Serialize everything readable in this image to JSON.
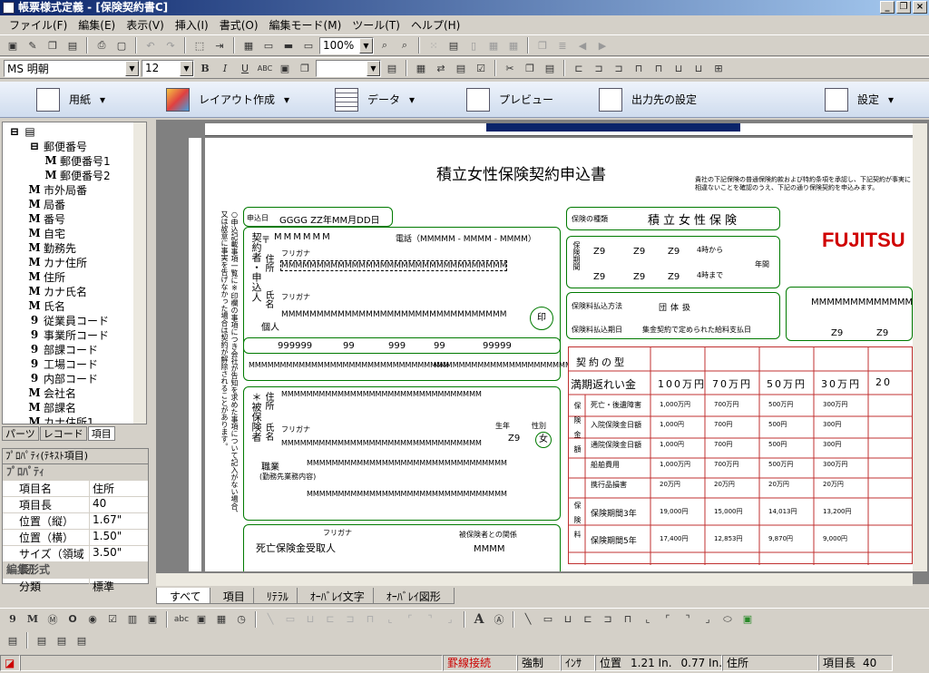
{
  "window": {
    "title": "帳票様式定義 - [保険契約書C]"
  },
  "menu": [
    "ファイル(F)",
    "編集(E)",
    "表示(V)",
    "挿入(I)",
    "書式(O)",
    "編集モード(M)",
    "ツール(T)",
    "ヘルプ(H)"
  ],
  "toolbar": {
    "zoom": "100%",
    "font": "MS 明朝",
    "size": "12",
    "bold": "B",
    "italic": "I",
    "underline": "U",
    "abc": "ABC"
  },
  "ribbon": [
    {
      "label": "用紙",
      "arrow": "▾"
    },
    {
      "label": "レイアウト作成",
      "arrow": "▾"
    },
    {
      "label": "データ",
      "arrow": "▾"
    },
    {
      "label": "プレビュー",
      "arrow": ""
    },
    {
      "label": "出力先の設定",
      "arrow": ""
    },
    {
      "label": "設定",
      "arrow": "▾"
    }
  ],
  "tree": {
    "items": [
      {
        "icon": "⊟",
        "label": "郵便番号",
        "indent": 1
      },
      {
        "icon": "M",
        "label": "郵便番号1",
        "indent": 2
      },
      {
        "icon": "M",
        "label": "郵便番号2",
        "indent": 2
      },
      {
        "icon": "M",
        "label": "市外局番",
        "indent": 1
      },
      {
        "icon": "M",
        "label": "局番",
        "indent": 1
      },
      {
        "icon": "M",
        "label": "番号",
        "indent": 1
      },
      {
        "icon": "M",
        "label": "自宅",
        "indent": 1
      },
      {
        "icon": "M",
        "label": "勤務先",
        "indent": 1
      },
      {
        "icon": "M",
        "label": "カナ住所",
        "indent": 1
      },
      {
        "icon": "M",
        "label": "住所",
        "indent": 1
      },
      {
        "icon": "M",
        "label": "カナ氏名",
        "indent": 1
      },
      {
        "icon": "M",
        "label": "氏名",
        "indent": 1
      },
      {
        "icon": "9",
        "label": "従業員コード",
        "indent": 1
      },
      {
        "icon": "9",
        "label": "事業所コード",
        "indent": 1
      },
      {
        "icon": "9",
        "label": "部課コード",
        "indent": 1
      },
      {
        "icon": "9",
        "label": "工場コード",
        "indent": 1
      },
      {
        "icon": "9",
        "label": "内部コード",
        "indent": 1
      },
      {
        "icon": "M",
        "label": "会社名",
        "indent": 1
      },
      {
        "icon": "M",
        "label": "部課名",
        "indent": 1
      },
      {
        "icon": "M",
        "label": "カナ住所1",
        "indent": 1
      }
    ],
    "tabs": [
      "パーツ",
      "レコード",
      "項目"
    ]
  },
  "props": {
    "header": "ﾌﾟﾛﾊﾟﾃｨ(ﾃｷｽﾄ項目)",
    "section1": "ﾌﾟﾛﾊﾟﾃｨ",
    "rows": [
      {
        "k": "項目名",
        "v": "住所"
      },
      {
        "k": "項目長",
        "v": "40"
      },
      {
        "k": "位置（縦）",
        "v": "1.67\""
      },
      {
        "k": "位置（横）",
        "v": "1.50\""
      },
      {
        "k": "サイズ（領域長）",
        "v": "3.50\""
      }
    ],
    "section2": "編集形式",
    "rows2": [
      {
        "k": "分類",
        "v": "標準"
      }
    ]
  },
  "form": {
    "title": "積立女性保険契約申込書",
    "brand": "FUJITSU",
    "notice": "貴社の下記保険の普通保険約款および特約条項を承認し、下記契約が事実に相違ないことを確認のうえ、下記の通り保険契約を申込みます。",
    "left_notice": "○申込記載事項一覧に※印欄の事項につき会社が告知を求めた事項について記入がない場合、又は故意に事実を告げなかった場合は契約が解除されることがあります。",
    "date_label": "申込日",
    "date_val": "GGGG ZZ年MM月DD日",
    "zip_label": "〒",
    "zip_val": "MMMMMM",
    "tel_label": "電話（MMMMM - MMMM - MMMM）",
    "keiyakusha": "契約者・申込人",
    "furigana": "フリガナ",
    "addr_label": "住所",
    "name_label": "氏名",
    "kojin": "個人",
    "stamp": "印",
    "codes": [
      "999999",
      "99",
      "999",
      "99",
      "99999"
    ],
    "hihokensha": "＊被保険者",
    "shokugyo": "職業",
    "shokugyo_sub": "(勤務先業務内容)",
    "seinen": "生年",
    "age": "Z9",
    "sex": "性別",
    "sex_val": "女",
    "shibou": "死亡保険金受取人",
    "kankei": "被保険者との関係",
    "kankei_val": "MMMM",
    "right_labels": [
      "保険の種類",
      "保険料払込方法",
      "保険料払込期日"
    ],
    "hoken_type": "積立女性保険",
    "period_label": "保険期間",
    "z9": "Z9",
    "kara": "4時から",
    "made": "4時まで",
    "nen": "年間",
    "haraikomi_val": "団体扱",
    "kijitsu_val": "集金契約で定められた給料支払日",
    "keiyaku_gata": "契約の型",
    "manki": "満期返れい金",
    "amounts": [
      "100万円",
      "70万円",
      "50万円",
      "30万円",
      "20"
    ],
    "shibo_rows": [
      "死亡・後遺障害",
      "入院保険金日額",
      "通院保険金日額",
      "船舶費用",
      "携行品損害"
    ],
    "kikan_rows": [
      "保険期間3年",
      "保険期間5年"
    ],
    "side_v": [
      "保険金額",
      "保険料"
    ],
    "vals": [
      [
        "1,000万円",
        "700万円",
        "500万円",
        "300万円"
      ],
      [
        "1,000円",
        "700円",
        "500円",
        "300円"
      ],
      [
        "1,000円",
        "700円",
        "500円",
        "300円"
      ],
      [
        "1,000万円",
        "700万円",
        "500万円",
        "300万円"
      ],
      [
        "20万円",
        "20万円",
        "20万円",
        "20万円"
      ]
    ],
    "pvals": [
      [
        "19,000円",
        "15,000円",
        "14,013円",
        "13,200円"
      ],
      [
        "17,400円",
        "12,853円",
        "9,870円",
        "9,000円"
      ]
    ],
    "m_dummy": "MMMMMMMMMMMMMMMMMMMMMMMMMMMMMMMM"
  },
  "bottom_tabs": [
    "すべて",
    "項目",
    "ﾘﾃﾗﾙ",
    "ｵｰﾊﾞﾚｲ文字",
    "ｵｰﾊﾞﾚｲ図形"
  ],
  "status": {
    "mode": "罫線接続",
    "force": "強制",
    "ins": "ｲﾝｻ",
    "pos_label": "位置",
    "pos_x": "1.21 In.",
    "pos_y": "0.77 In.",
    "item": "住所",
    "len_label": "項目長",
    "len_val": "40"
  },
  "colors": {
    "accent": "#0a246a",
    "form_green": "#007a00",
    "form_red": "#c03030"
  }
}
